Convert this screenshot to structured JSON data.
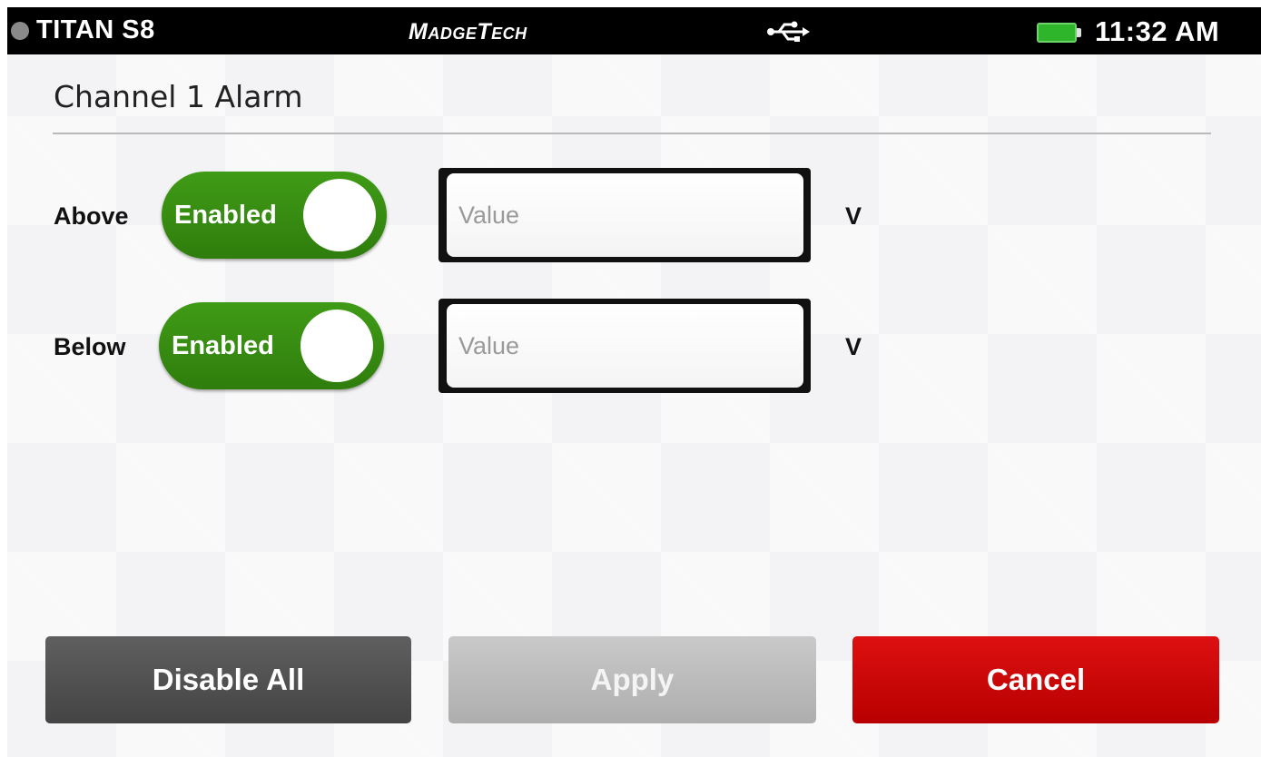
{
  "status_bar": {
    "device_name": "TITAN S8",
    "brand": "MadgeTech",
    "time": "11:32 AM",
    "icons": [
      "status-dot-icon",
      "usb-icon",
      "battery-icon"
    ],
    "battery_color": "#2fb52c"
  },
  "page": {
    "title": "Channel 1 Alarm"
  },
  "alarms": [
    {
      "label": "Above",
      "toggle_label": "Enabled",
      "enabled": true,
      "value": "",
      "placeholder": "Value",
      "unit": "V"
    },
    {
      "label": "Below",
      "toggle_label": "Enabled",
      "enabled": true,
      "value": "",
      "placeholder": "Value",
      "unit": "V"
    }
  ],
  "buttons": {
    "disable_all": "Disable All",
    "apply": "Apply",
    "cancel": "Cancel"
  },
  "colors": {
    "toggle_on": "#3a9214",
    "cancel": "#d40a0a",
    "disable_all": "#555555",
    "apply_disabled": "#bcbcbc"
  }
}
